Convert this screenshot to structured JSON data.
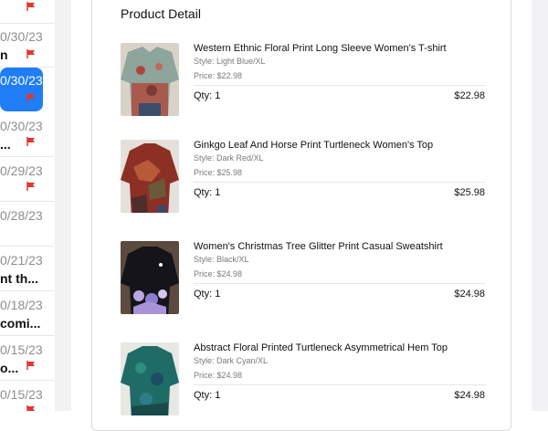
{
  "message_list": {
    "rows": [
      {
        "date": "",
        "line2": "",
        "flag": true,
        "selected": false
      },
      {
        "date": "0/30/23",
        "line2": "n",
        "flag": true,
        "selected": false
      },
      {
        "date": "0/30/23",
        "line2": "",
        "flag": true,
        "selected": true
      },
      {
        "date": "0/30/23",
        "line2": "...",
        "flag": true,
        "selected": false
      },
      {
        "date": "0/29/23",
        "line2": "",
        "flag": true,
        "selected": false
      },
      {
        "date": "0/28/23",
        "line2": "",
        "flag": false,
        "selected": false
      },
      {
        "date": "0/21/23",
        "line2": "nt th...",
        "flag": false,
        "selected": false
      },
      {
        "date": "0/18/23",
        "line2": "comi...",
        "flag": false,
        "selected": false
      },
      {
        "date": "0/15/23",
        "line2": "o...",
        "flag": true,
        "selected": false
      },
      {
        "date": "0/15/23",
        "line2": "",
        "flag": true,
        "selected": false
      }
    ]
  },
  "product_detail": {
    "title": "Product Detail",
    "items": [
      {
        "name": "Western Ethnic Floral Print Long Sleeve Women's T-shirt",
        "style": "Style: Light Blue/XL",
        "price": "Price: $22.98",
        "qty": "Qty: 1",
        "amount": "$22.98"
      },
      {
        "name": "Ginkgo Leaf And Horse Print Turtleneck Women's Top",
        "style": "Style: Dark Red/XL",
        "price": "Price: $25.98",
        "qty": "Qty: 1",
        "amount": "$25.98"
      },
      {
        "name": "Women's Christmas Tree Glitter Print Casual Sweatshirt",
        "style": "Style: Black/XL",
        "price": "Price: $24.98",
        "qty": "Qty: 1",
        "amount": "$24.98"
      },
      {
        "name": "Abstract Floral Printed Turtleneck Asymmetrical Hem Top",
        "style": "Style: Dark Cyan/XL",
        "price": "Price: $24.98",
        "qty": "Qty: 1",
        "amount": "$24.98"
      }
    ]
  },
  "colors": {
    "selection": "#1f7ef7",
    "flag": "#e6352b"
  },
  "icons": {
    "flag": "flag-icon"
  }
}
